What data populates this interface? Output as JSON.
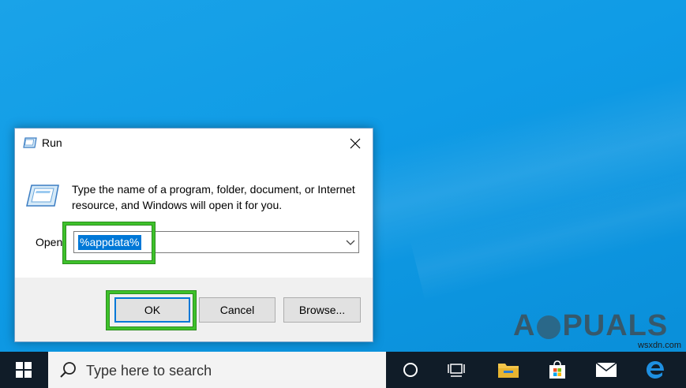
{
  "dialog": {
    "title": "Run",
    "description": "Type the name of a program, folder, document, or Internet resource, and Windows will open it for you.",
    "open_label": "Open:",
    "open_value": "%appdata%",
    "buttons": {
      "ok": "OK",
      "cancel": "Cancel",
      "browse": "Browse..."
    }
  },
  "taskbar": {
    "search_placeholder": "Type here to search",
    "items": [
      "start-icon",
      "search-icon",
      "cortana-icon",
      "task-view-icon",
      "file-explorer-icon",
      "store-icon",
      "mail-icon",
      "edge-icon"
    ]
  },
  "watermark": {
    "brand": "APPUALS",
    "site": "wsxdn.com"
  },
  "colors": {
    "desktop": "#0f9be6",
    "highlight": "#3ec12b",
    "selection": "#0078d7",
    "taskbar": "#101c28"
  }
}
